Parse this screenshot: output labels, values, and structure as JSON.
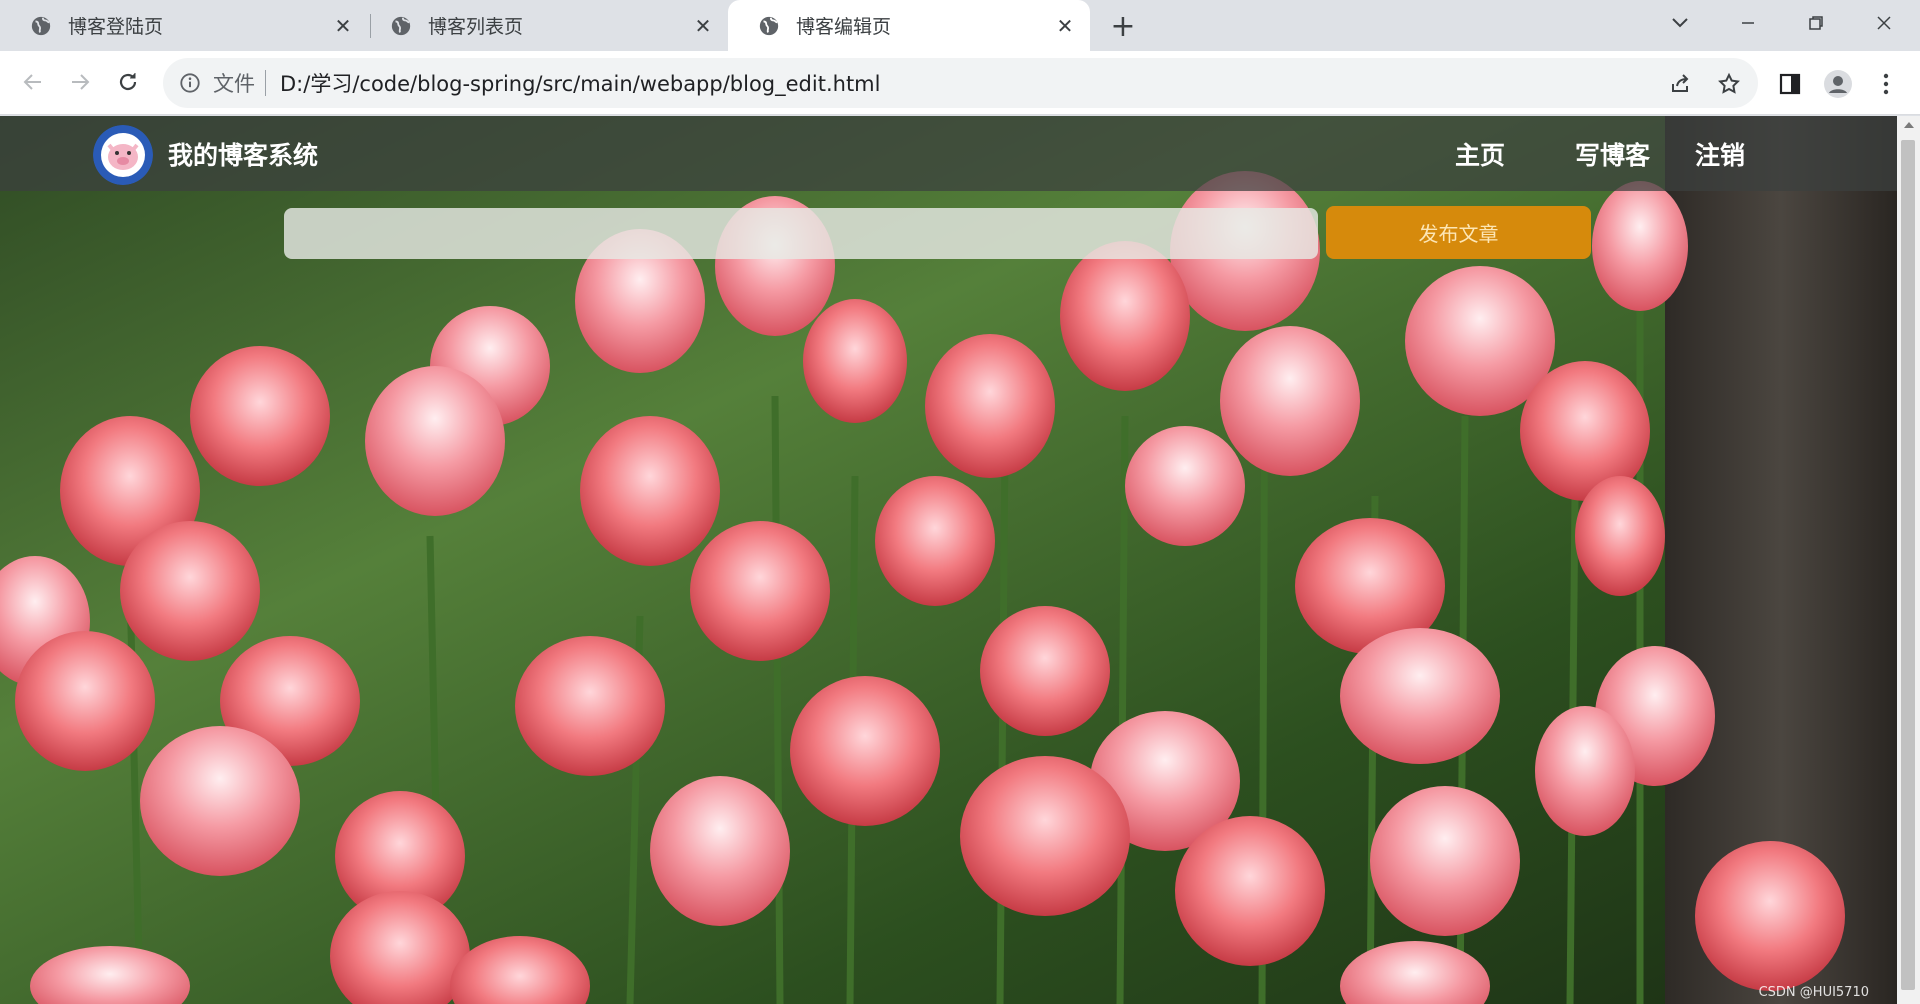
{
  "browser": {
    "tabs": [
      {
        "title": "博客登陆页",
        "active": false
      },
      {
        "title": "博客列表页",
        "active": false
      },
      {
        "title": "博客编辑页",
        "active": true
      }
    ],
    "close_glyph": "✕",
    "new_tab_glyph": "+",
    "omnibox": {
      "security_label": "文件",
      "url": "D:/学习/code/blog-spring/src/main/webapp/blog_edit.html"
    }
  },
  "page": {
    "site_title": "我的博客系统",
    "nav": {
      "home": "主页",
      "write": "写博客",
      "logout": "注销"
    },
    "editor": {
      "title_value": "",
      "publish_label": "发布文章"
    },
    "watermark": "CSDN @HUI5710"
  },
  "colors": {
    "accent_button": "#d68a0c",
    "navbar": "rgba(60,64,62,0.72)"
  }
}
